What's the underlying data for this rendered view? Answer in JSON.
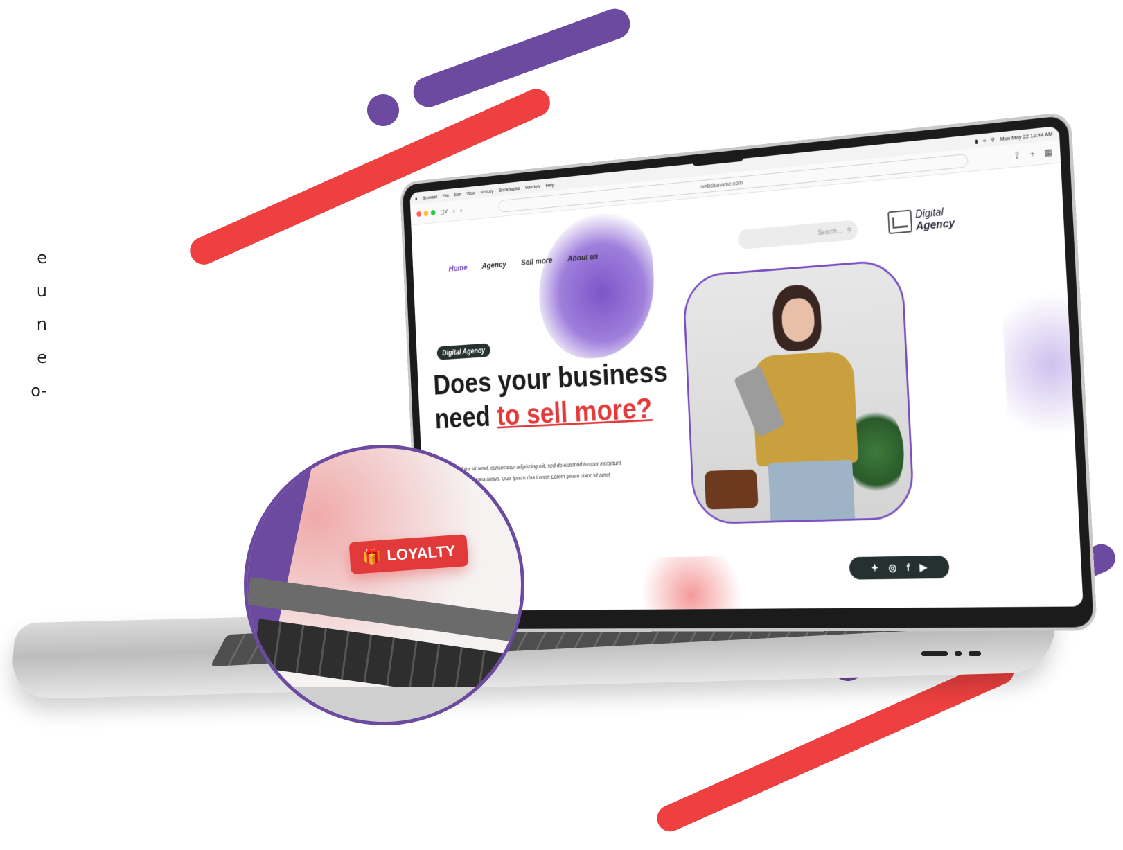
{
  "colors": {
    "accent_purple": "#6b4aa0",
    "accent_red": "#ee4040",
    "dark_pill": "#263230"
  },
  "side_paragraph": {
    "lines": [
      "e",
      "u",
      "n",
      "e",
      "o-"
    ]
  },
  "mac_menubar": {
    "apple_icon": "apple-icon",
    "items": [
      "Browser",
      "File",
      "Edit",
      "View",
      "History",
      "Bookmarks",
      "Window",
      "Help"
    ],
    "status": "Mon May 22  12:44 AM"
  },
  "browser": {
    "url": "websitename.com",
    "traffic_lights": [
      "#ff5f57",
      "#febc2e",
      "#28c840"
    ],
    "controls": [
      "sidebar-icon",
      "back-icon",
      "forward-icon"
    ],
    "actions": [
      "share-icon",
      "new-tab-icon",
      "tabs-icon"
    ]
  },
  "site": {
    "nav": [
      {
        "label": "Home",
        "active": true
      },
      {
        "label": "Agency",
        "active": false
      },
      {
        "label": "Sell more",
        "active": false
      },
      {
        "label": "About us",
        "active": false
      }
    ],
    "search_placeholder": "Search...",
    "logo": {
      "line1": "Digital",
      "line2": "Agency"
    },
    "pill": "Digital Agency",
    "headline_line1": "Does your business",
    "headline_prefix": "need ",
    "headline_highlight": "to sell more?",
    "lorem": "Lorem ipsum dolor sit amet, consectetur adipiscing elit, sed do eiusmod tempor incididunt ut labore et dolore magna aliqua. Quis ipsum dua Lorem Lorem ipsum dolor sit amet",
    "social": [
      "twitter-icon",
      "instagram-icon",
      "facebook-icon",
      "youtube-icon"
    ]
  },
  "magnifier": {
    "badge_label": "LOYALTY",
    "badge_icon": "gift-icon"
  }
}
